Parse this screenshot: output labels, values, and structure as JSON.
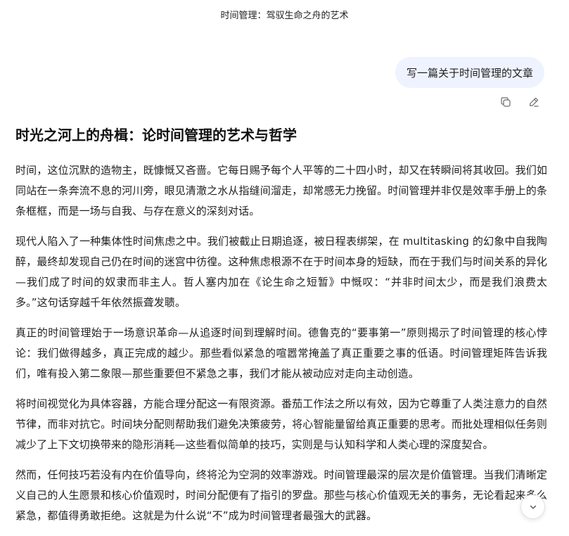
{
  "header": {
    "title": "时间管理：驾驭生命之舟的艺术"
  },
  "user_message": {
    "text": "写一篇关于时间管理的文章",
    "actions": [
      "copy-icon",
      "edit-icon"
    ]
  },
  "article": {
    "title": "时光之河上的舟楫：论时间管理的艺术与哲学",
    "paragraphs": [
      "时间，这位沉默的造物主，既慷慨又吝啬。它每日赐予每个人平等的二十四小时，却又在转瞬间将其收回。我们如同站在一条奔流不息的河川旁，眼见清澈之水从指缝间溜走，却常感无力挽留。时间管理并非仅是效率手册上的条条框框，而是一场与自我、与存在意义的深刻对话。",
      "现代人陷入了一种集体性时间焦虑之中。我们被截止日期追逐，被日程表绑架，在 multitasking 的幻象中自我陶醉，最终却发现自己仍在时间的迷宫中彷徨。这种焦虑根源不在于时间本身的短缺，而在于我们与时间关系的异化—我们成了时间的奴隶而非主人。哲人塞内加在《论生命之短暂》中慨叹：“并非时间太少，而是我们浪费太多。”这句话穿越千年依然振聋发聩。",
      "真正的时间管理始于一场意识革命—从追逐时间到理解时间。德鲁克的“要事第一”原则揭示了时间管理的核心悖论：我们做得越多，真正完成的越少。那些看似紧急的喧嚣常掩盖了真正重要之事的低语。时间管理矩阵告诉我们，唯有投入第二象限—那些重要但不紧急之事，我们才能从被动应对走向主动创造。",
      "将时间视觉化为具体容器，方能合理分配这一有限资源。番茄工作法之所以有效，因为它尊重了人类注意力的自然节律，而非对抗它。时间块分配则帮助我们避免决策疲劳，将心智能量留给真正重要的思考。而批处理相似任务则减少了上下文切换带来的隐形消耗—这些看似简单的技巧，实则是与认知科学和人类心理的深度契合。",
      "然而，任何技巧若没有内在价值导向，终将沦为空洞的效率游戏。时间管理最深的层次是价值管理。当我们清晰定义自己的人生愿景和核心价值观时，时间分配便有了指引的罗盘。那些与核心价值观无关的事务，无论看起来多么紧急，都值得勇敢拒绝。这就是为什么说“不”成为时间管理者最强大的武器。"
    ]
  },
  "scroll_button": {
    "icon": "chevron-down-icon"
  }
}
